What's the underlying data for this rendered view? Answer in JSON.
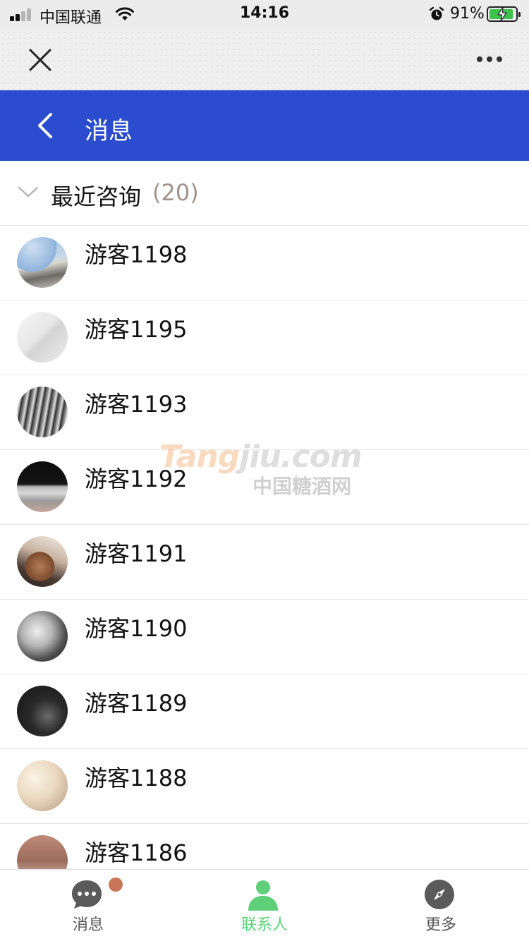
{
  "status_bar": {
    "carrier": "中国联通",
    "time": "14:16",
    "battery": "91%",
    "battery_level": 0.91,
    "signal_bars": 2,
    "icons": [
      "signal-icon",
      "wifi-icon",
      "alarm-icon",
      "battery-charging-icon"
    ]
  },
  "webview": {
    "close_icon": "close-icon",
    "more_icon": "more-icon"
  },
  "header": {
    "back_icon": "back-icon",
    "title": "消息",
    "color": "#2c4ccf"
  },
  "section": {
    "label": "最近咨询",
    "count": "(20)",
    "chevron_icon": "chevron-down-icon"
  },
  "contacts": [
    {
      "name": "游客1198"
    },
    {
      "name": "游客1195"
    },
    {
      "name": "游客1193"
    },
    {
      "name": "游客1192"
    },
    {
      "name": "游客1191"
    },
    {
      "name": "游客1190"
    },
    {
      "name": "游客1189"
    },
    {
      "name": "游客1188"
    },
    {
      "name": "游客1186"
    }
  ],
  "watermark": {
    "brand_a": "Tang",
    "brand_b": "jiu.com",
    "sub": "中国糖酒网"
  },
  "tabs": [
    {
      "label": "消息",
      "icon": "chat-bubble-icon",
      "active": false,
      "badge": true
    },
    {
      "label": "联系人",
      "icon": "contact-person-icon",
      "active": true,
      "badge": false
    },
    {
      "label": "更多",
      "icon": "compass-icon",
      "active": false,
      "badge": false
    }
  ],
  "colors": {
    "accent_active": "#5fcf7a",
    "badge": "#c8755a",
    "count_text": "#a0948a"
  }
}
